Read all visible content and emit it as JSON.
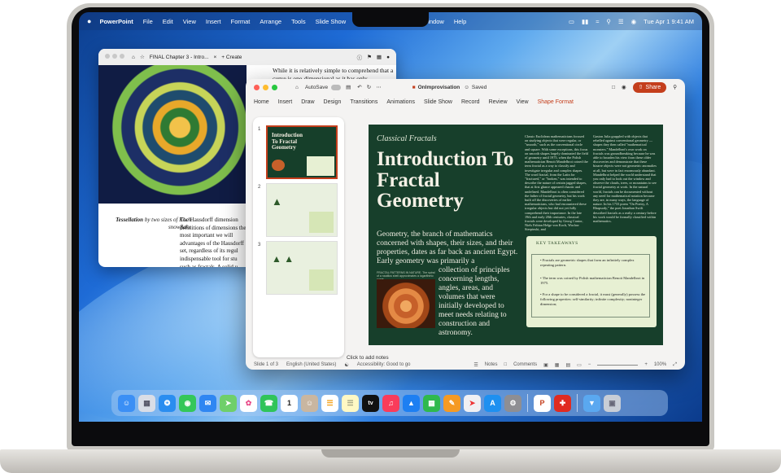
{
  "menubar": {
    "app": "PowerPoint",
    "items": [
      "File",
      "Edit",
      "View",
      "Insert",
      "Format",
      "Arrange",
      "Tools",
      "Slide Show"
    ],
    "items_right": [
      "Window",
      "Help"
    ],
    "datetime": "Tue Apr 1  9:41 AM"
  },
  "reader": {
    "tab_title": "FINAL Chapter 3 - Intro...",
    "create_label": "+ Create",
    "top_text": "While it is relatively simple to comprehend that a curve is one-dimensional as it has only",
    "caption_bold": "Tessellation",
    "caption_rest": " by two sizes of Koch snowflake",
    "body": "The Hausdorff dimension definitions of dimensions the most important we will advantages of the Hausdorff set, regardless of its regul indispensable tool for stu such as fractals. A solid u measure is essential for a"
  },
  "ppt": {
    "autosave": "AutoSave",
    "doc_title": "OnImprovisation",
    "saved": "Saved",
    "share_label": "Share",
    "tabs": [
      "Home",
      "Insert",
      "Draw",
      "Design",
      "Transitions",
      "Animations",
      "Slide Show",
      "Record",
      "Review",
      "View",
      "Shape Format"
    ],
    "thumb_numbers": [
      "1",
      "2",
      "3"
    ],
    "thumb1_title": "Introduction To Fractal Geometry",
    "slide": {
      "subtitle": "Classical Fractals",
      "title": "Introduction To Fractal Geometry",
      "body_a": "Geometry, the branch of mathematics concerned with shapes, their sizes, and their properties, dates as far back as ancient Egypt. Early geometry was primarily a",
      "body_b": "collection of principles concerning lengths, angles, areas, and volumes that were initially developed to meet needs relating to construction and astronomy.",
      "shell_note": "FRACTAL PATTERNS IN NATURE. The spiral of a nautilus shell approximates a logarithmic curve.",
      "col1": "Classic Euclidean mathematicians focused on studying objects that were regular, or \"smooth,\" such as the conventional circle and square. With some exceptions, this focus on smooth shapes largely dominated the field of geometry until 1975, when the Polish mathematician Benoit Mandelbrot coined the term fractal as a way to classify and investigate irregular and complex shapes. The word fractal, from the Latin for \"fractured,\" or \"broken,\" was intended to describe the nature of certain jagged shapes, that at first glance appeared chaotic and undefined. Mandelbrot is often considered the father of fractal geometry, but his work built off the discoveries of earlier mathematicians, who had encountered these irregular objects but did not yet fully comprehend their importance. In the late 19th and early 20th centuries, classical fractals were developed by Georg Cantor, Niels Fabian Helge von Koch, Waclaw Sierpinski, and",
      "col2": "Gaston Julia grappled with objects that rebelled against conventional geometry — shapes they then called \"mathematical monsters.\" Mandelbrot's own work on fractals was groundbreaking because he was able to broaden his view from these older discoveries and demonstrate that these bizarre objects were not geometric anomalies at all, but were in fact enormously abundant. Mandelbrot helped the world understand that you only had to look out the window and observe the clouds, trees, or mountains to see fractal geometry at work. In the natural world, fractals can be documented without any need for mathematical notation because they are, in many ways, the language of nature. In his 1733 poem \"On Poetry, A Rhapsody,\" the poet Jonathan Swift described fractals as a realty a century before his work would be formally classified within mathematics.",
      "kt_title": "KEY TAKEAWAYS",
      "kt_items": [
        "Fractals are geometric shapes that form an infinitely complex repeating pattern.",
        "The term was coined by Polish mathematician Benoit Mandelbrot in 1975.",
        "For a shape to be considered a fractal, it must (generally) possess the following properties: self-similarity; infinite complexity; noninteger dimension;"
      ]
    },
    "notes_hint": "Click to add notes",
    "status_slide": "Slide 1 of 3",
    "status_lang": "English (United States)",
    "status_access": "Accessibility: Good to go",
    "status_notes": "Notes",
    "status_comments": "Comments",
    "zoom": "100%"
  },
  "dock": {
    "apps": [
      "finder-icon",
      "launchpad-icon",
      "safari-icon",
      "messages-icon",
      "mail-icon",
      "maps-icon",
      "photos-icon",
      "facetime-icon",
      "calendar-icon",
      "contacts-icon",
      "reminders-icon",
      "notes-icon",
      "tv-icon",
      "music-icon",
      "keynote-icon",
      "numbers-icon",
      "pages-icon",
      "rocket-icon",
      "appstore-icon",
      "settings-icon",
      "powerpoint-icon",
      "acrobat-icon",
      "downloads-icon",
      "trash-icon"
    ],
    "calendar_day": "1",
    "tv_label": "tv"
  },
  "colors": {
    "accent": "#c43e1c",
    "slide_bg": "#173f2b",
    "takeaways_bg": "#e7f0d3"
  }
}
